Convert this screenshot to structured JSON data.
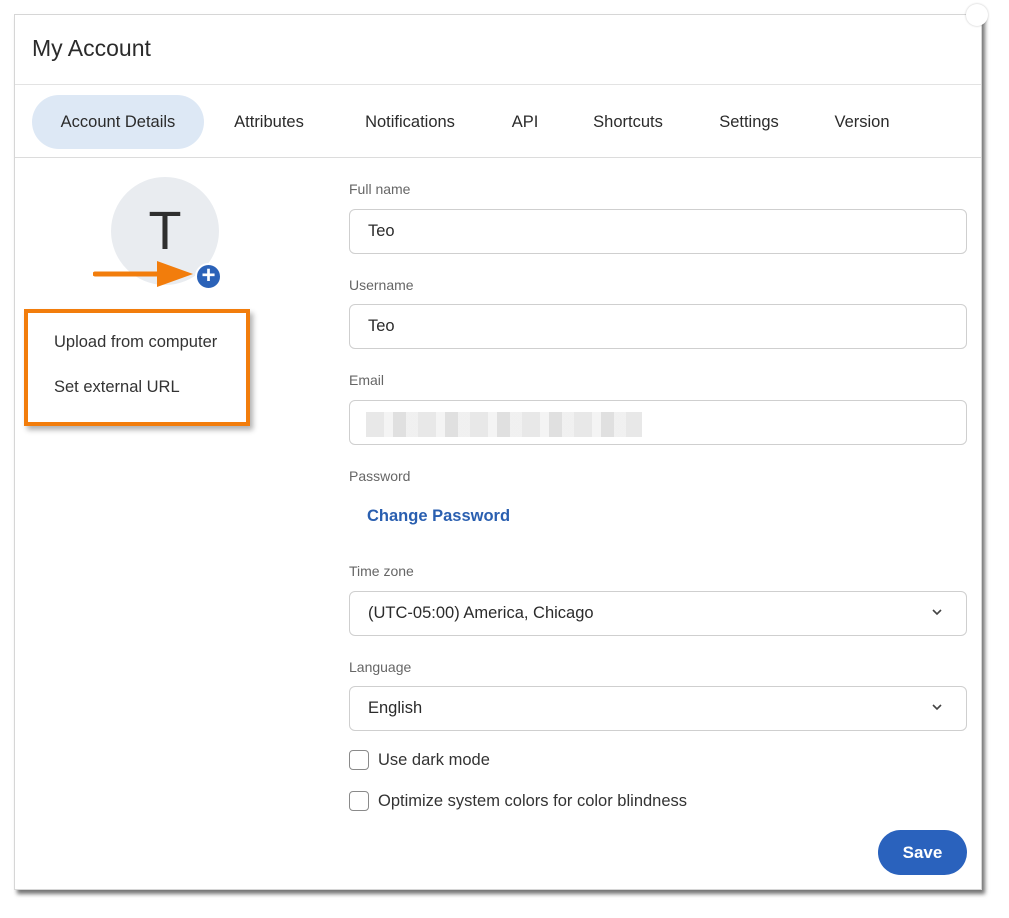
{
  "dialog": {
    "title": "My Account"
  },
  "tabs": [
    {
      "label": "Account Details",
      "active": true
    },
    {
      "label": "Attributes"
    },
    {
      "label": "Notifications"
    },
    {
      "label": "API"
    },
    {
      "label": "Shortcuts"
    },
    {
      "label": "Settings"
    },
    {
      "label": "Version"
    }
  ],
  "avatar": {
    "initial": "T",
    "add_icon": "plus-icon",
    "add_symbol": "+"
  },
  "avatar_menu": {
    "items": [
      {
        "label": "Upload from computer"
      },
      {
        "label": "Set external URL"
      }
    ]
  },
  "form": {
    "full_name": {
      "label": "Full name",
      "value": "Teo"
    },
    "username": {
      "label": "Username",
      "value": "Teo"
    },
    "email": {
      "label": "Email"
    },
    "password": {
      "label": "Password",
      "link": "Change Password"
    },
    "time_zone": {
      "label": "Time zone",
      "value": "(UTC-05:00) America, Chicago"
    },
    "language": {
      "label": "Language",
      "value": "English"
    },
    "dark_mode": {
      "label": "Use dark mode",
      "checked": false
    },
    "color_blind": {
      "label": "Optimize system colors for color blindness",
      "checked": false
    },
    "save_label": "Save"
  },
  "colors": {
    "accent": "#2a62bd",
    "active_tab_bg": "#dde8f5",
    "annotation": "#f27d0c"
  }
}
